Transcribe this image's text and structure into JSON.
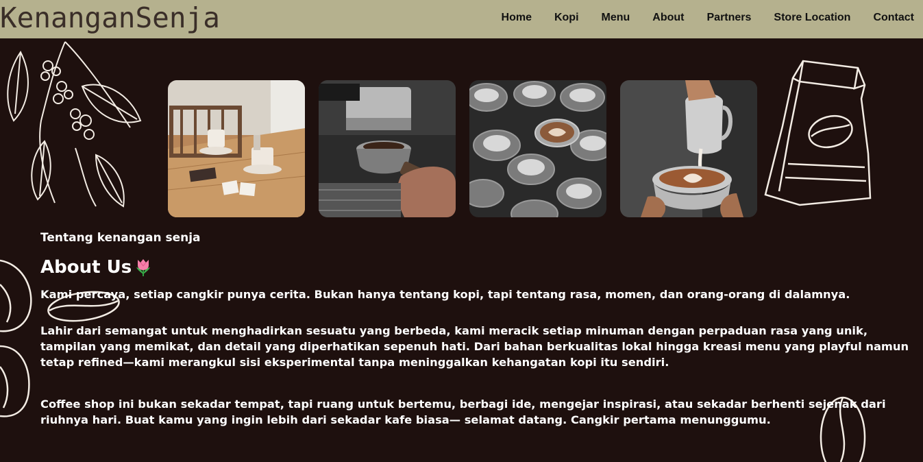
{
  "brand": "KenanganSenja",
  "nav": {
    "home": "Home",
    "kopi": "Kopi",
    "menu": "Menu",
    "about": "About",
    "partners": "Partners",
    "store": "Store Location",
    "contact": "Contact"
  },
  "gallery": [
    {
      "name": "cafe-table-photo"
    },
    {
      "name": "espresso-machine-photo"
    },
    {
      "name": "coffee-cups-photo"
    },
    {
      "name": "latte-art-pour-photo"
    }
  ],
  "about": {
    "subtitle": "Tentang kenangan senja",
    "heading": "About Us",
    "heading_icon": "tulip-icon",
    "p1": "Kami percaya, setiap cangkir punya cerita. Bukan hanya tentang kopi, tapi tentang rasa, momen, dan orang-orang di dalamnya.",
    "p2": "Lahir dari semangat untuk menghadirkan sesuatu yang berbeda, kami meracik setiap minuman dengan perpaduan rasa yang unik, tampilan yang memikat, dan detail yang diperhatikan sepenuh hati. Dari bahan berkualitas lokal hingga kreasi menu yang playful namun tetap refined—kami merangkul sisi eksperimental tanpa meninggalkan kehangatan kopi itu sendiri.",
    "p3": "Coffee shop ini bukan sekadar tempat, tapi ruang untuk bertemu, berbagi ide, mengejar inspirasi, atau sekadar berhenti sejenak dari riuhnya hari. Buat kamu yang ingin lebih dari sekadar kafe biasa— selamat datang. Cangkir pertama menunggumu."
  },
  "colors": {
    "background": "#1e100e",
    "navbar": "#b5b18e",
    "brand_text": "#3a2e28",
    "text": "#ffffff"
  }
}
